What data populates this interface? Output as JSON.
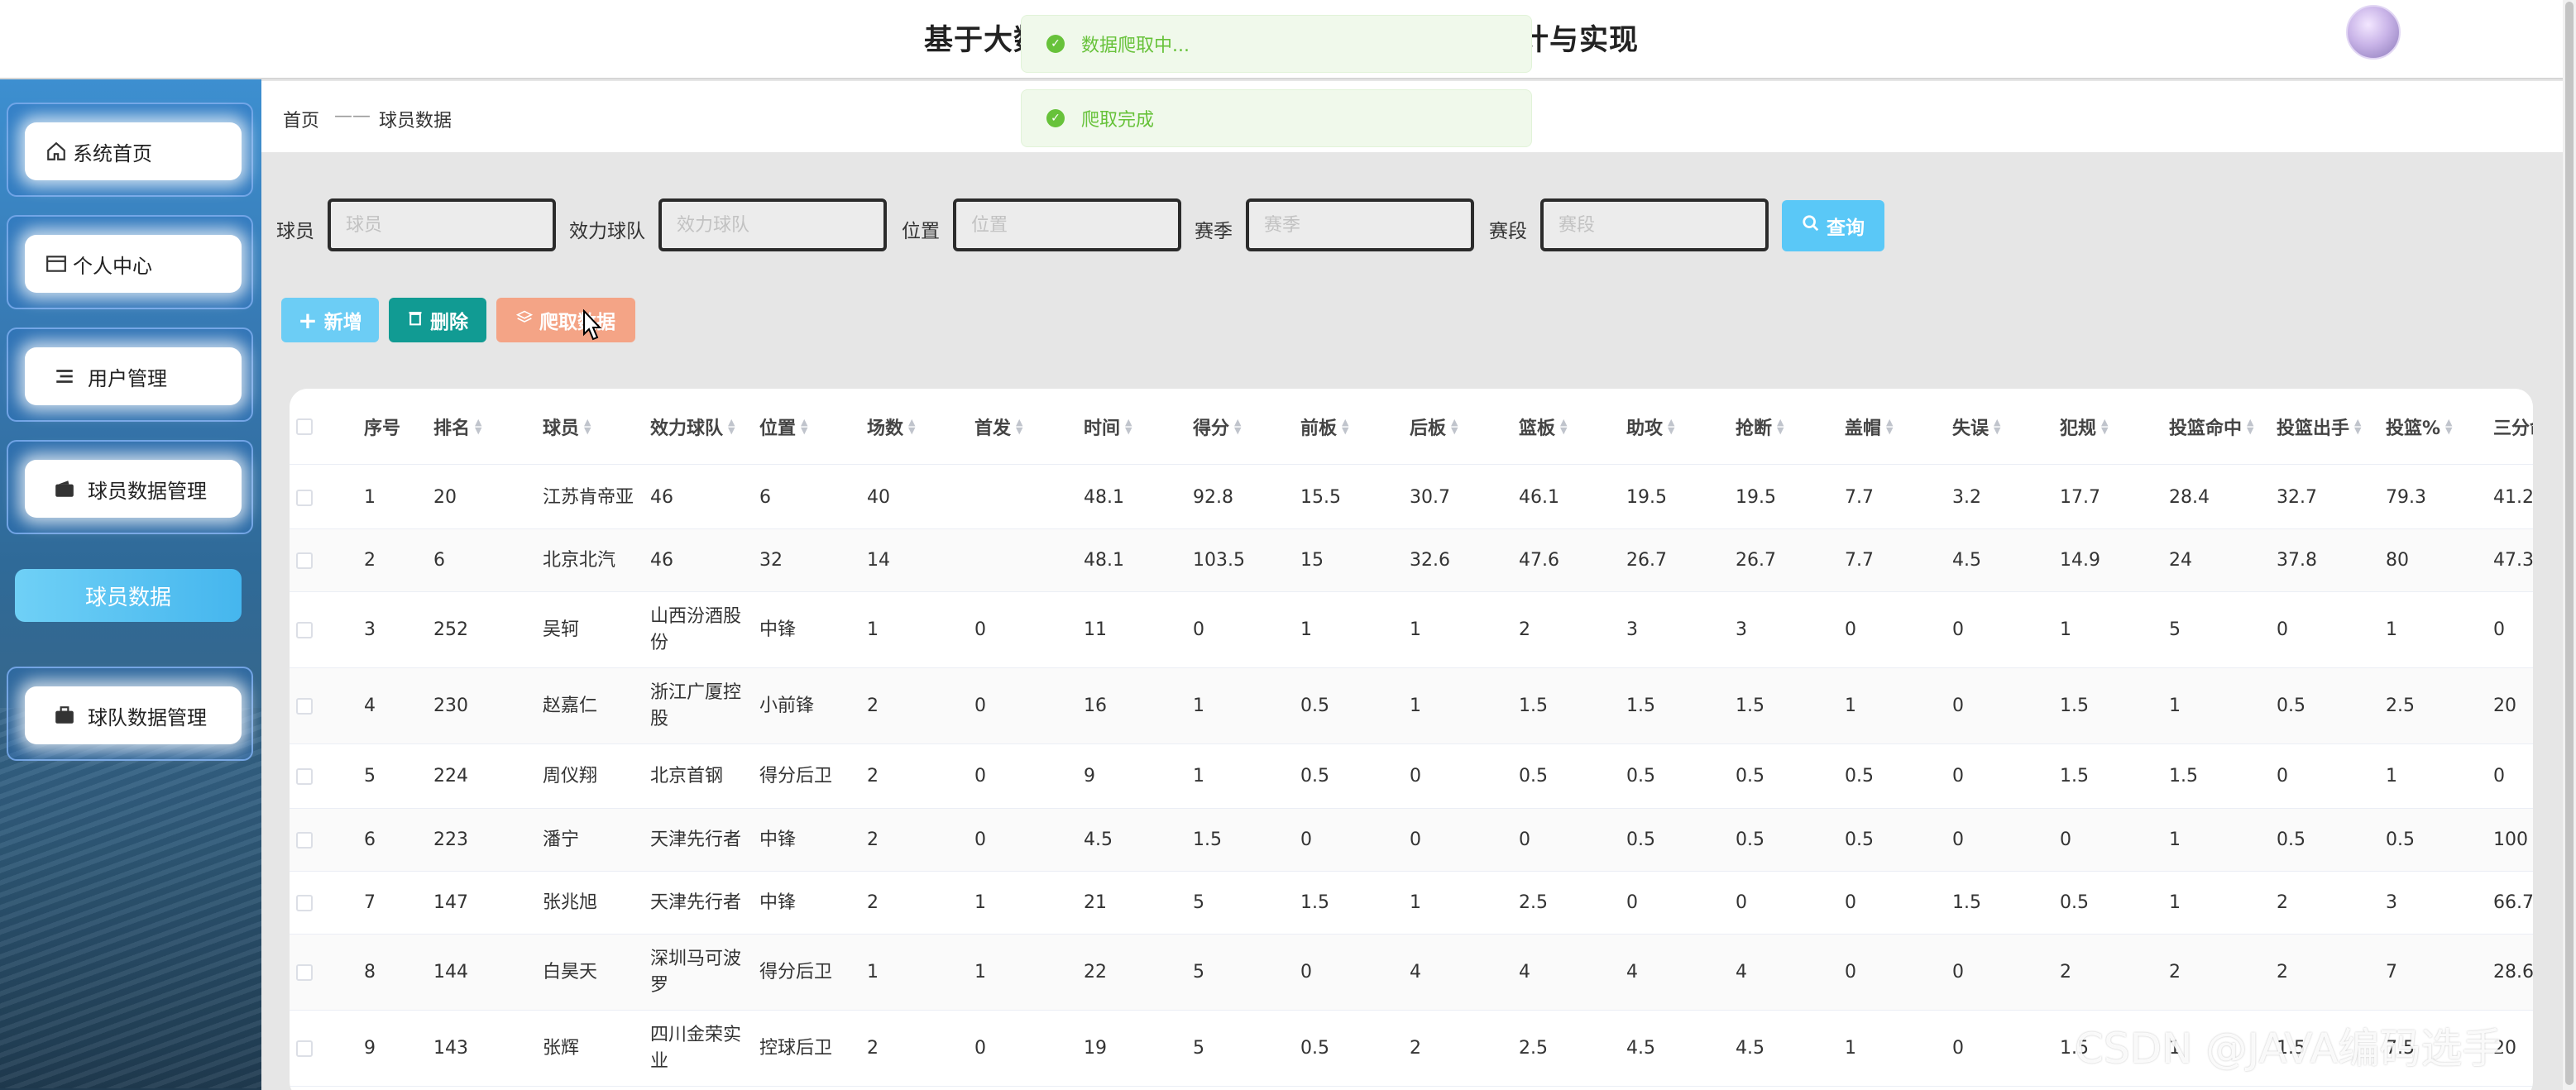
{
  "header": {
    "title": "基于大数据的国内篮球数据可视化分析系统设计与实现"
  },
  "toasts": [
    {
      "text": "数据爬取中..."
    },
    {
      "text": "爬取完成"
    }
  ],
  "sidebar": {
    "items": [
      {
        "label": "系统首页",
        "icon": "home-icon"
      },
      {
        "label": "个人中心",
        "icon": "card-icon"
      },
      {
        "label": "用户管理",
        "icon": "list-icon"
      },
      {
        "label": "球员数据管理",
        "icon": "wallet-icon"
      },
      {
        "label": "球队数据管理",
        "icon": "briefcase-icon"
      }
    ],
    "sub_item": "球员数据"
  },
  "breadcrumb": {
    "home": "首页",
    "sep": "——",
    "current": "球员数据"
  },
  "search": {
    "fields": [
      {
        "label": "球员",
        "placeholder": "球员"
      },
      {
        "label": "效力球队",
        "placeholder": "效力球队"
      },
      {
        "label": "位置",
        "placeholder": "位置"
      },
      {
        "label": "赛季",
        "placeholder": "赛季"
      },
      {
        "label": "赛段",
        "placeholder": "赛段"
      }
    ],
    "query_label": "查询"
  },
  "actions": {
    "add": "新增",
    "delete": "删除",
    "crawl": "爬取数据"
  },
  "table": {
    "columns": [
      "序号",
      "排名",
      "球员",
      "效力球队",
      "位置",
      "场数",
      "首发",
      "时间",
      "得分",
      "前板",
      "后板",
      "篮板",
      "助攻",
      "抢断",
      "盖帽",
      "失误",
      "犯规",
      "投篮命中",
      "投篮出手",
      "投篮%",
      "三分命"
    ],
    "rows": [
      [
        "1",
        "20",
        "江苏肯帝亚",
        "46",
        "6",
        "40",
        "",
        "48.1",
        "92.8",
        "15.5",
        "30.7",
        "46.1",
        "19.5",
        "19.5",
        "7.7",
        "3.2",
        "17.7",
        "28.4",
        "32.7",
        "79.3",
        "41.2"
      ],
      [
        "2",
        "6",
        "北京北汽",
        "46",
        "32",
        "14",
        "",
        "48.1",
        "103.5",
        "15",
        "32.6",
        "47.6",
        "26.7",
        "26.7",
        "7.7",
        "4.5",
        "14.9",
        "24",
        "37.8",
        "80",
        "47.3"
      ],
      [
        "3",
        "252",
        "吴轲",
        "山西汾酒股\n份",
        "中锋",
        "1",
        "0",
        "11",
        "0",
        "1",
        "1",
        "2",
        "3",
        "3",
        "0",
        "0",
        "1",
        "5",
        "0",
        "1",
        "0"
      ],
      [
        "4",
        "230",
        "赵嘉仁",
        "浙江广厦控\n股",
        "小前锋",
        "2",
        "0",
        "16",
        "1",
        "0.5",
        "1",
        "1.5",
        "1.5",
        "1.5",
        "1",
        "0",
        "1.5",
        "1",
        "0.5",
        "2.5",
        "20"
      ],
      [
        "5",
        "224",
        "周仪翔",
        "北京首钢",
        "得分后卫",
        "2",
        "0",
        "9",
        "1",
        "0.5",
        "0",
        "0.5",
        "0.5",
        "0.5",
        "0.5",
        "0",
        "1.5",
        "1.5",
        "0",
        "1",
        "0"
      ],
      [
        "6",
        "223",
        "潘宁",
        "天津先行者",
        "中锋",
        "2",
        "0",
        "4.5",
        "1.5",
        "0",
        "0",
        "0",
        "0.5",
        "0.5",
        "0.5",
        "0",
        "0",
        "1",
        "0.5",
        "0.5",
        "100"
      ],
      [
        "7",
        "147",
        "张兆旭",
        "天津先行者",
        "中锋",
        "2",
        "1",
        "21",
        "5",
        "1.5",
        "1",
        "2.5",
        "0",
        "0",
        "0",
        "1.5",
        "0.5",
        "1",
        "2",
        "3",
        "66.7"
      ],
      [
        "8",
        "144",
        "白昊天",
        "深圳马可波\n罗",
        "得分后卫",
        "1",
        "1",
        "22",
        "5",
        "0",
        "4",
        "4",
        "4",
        "4",
        "0",
        "0",
        "2",
        "2",
        "2",
        "7",
        "28.6"
      ],
      [
        "9",
        "143",
        "张辉",
        "四川金荣实\n业",
        "控球后卫",
        "2",
        "0",
        "19",
        "5",
        "0.5",
        "2",
        "2.5",
        "4.5",
        "4.5",
        "1",
        "0",
        "1.5",
        "1",
        "1.5",
        "7.5",
        "20"
      ]
    ]
  },
  "watermark": "CSDN @JAVA编码选手"
}
